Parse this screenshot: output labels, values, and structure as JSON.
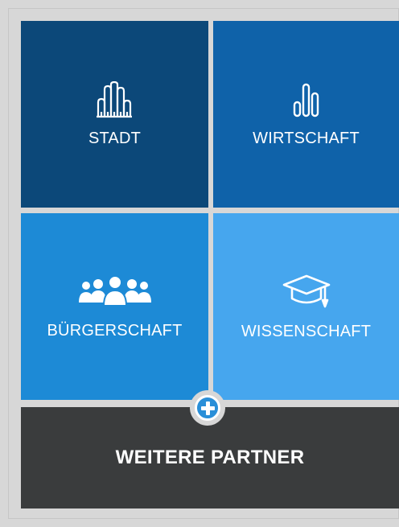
{
  "tiles": [
    {
      "label": "STADT",
      "icon": "city-icon",
      "color": "#0c4879"
    },
    {
      "label": "WIRTSCHAFT",
      "icon": "bar-chart-icon",
      "color": "#0f62a9"
    },
    {
      "label": "BÜRGERSCHAFT",
      "icon": "people-group-icon",
      "color": "#1d8ad6"
    },
    {
      "label": "WISSENSCHAFT",
      "icon": "graduation-cap-icon",
      "color": "#46a6ee"
    }
  ],
  "partner": {
    "label": "WEITERE PARTNER",
    "icon": "plus-icon",
    "color": "#3a3c3d"
  }
}
